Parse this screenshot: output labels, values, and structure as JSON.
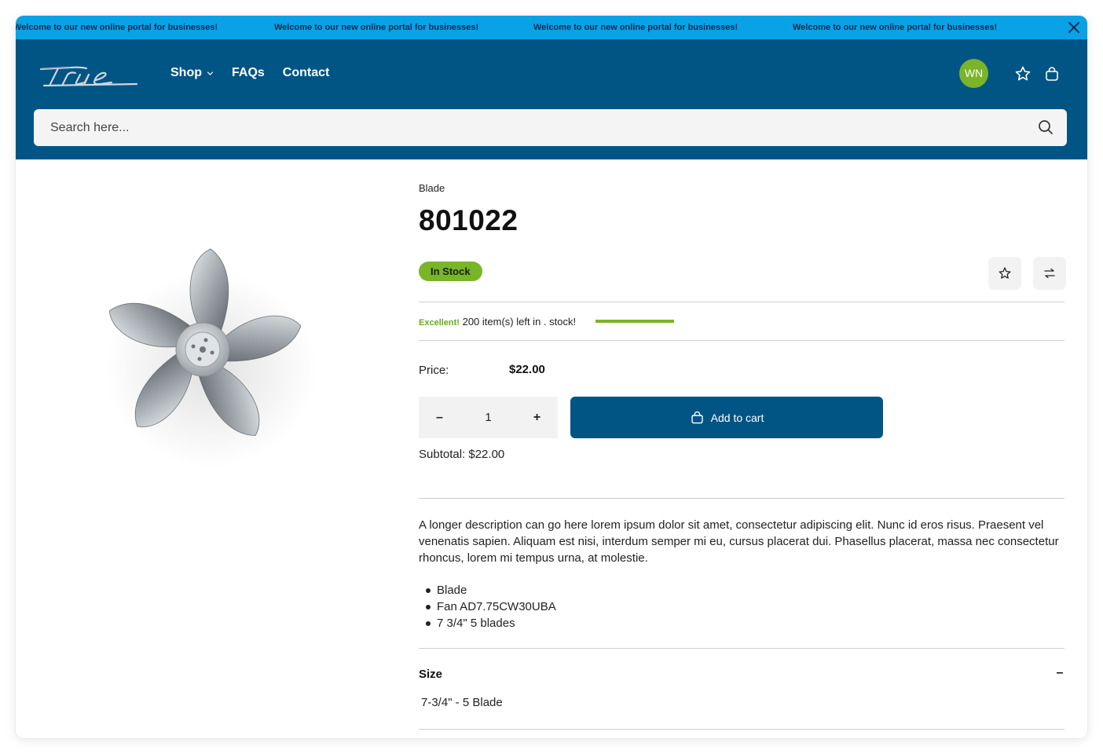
{
  "announcement": {
    "messages": [
      "Welcome to our new online portal for businesses!",
      "Welcome to our new online portal for businesses!",
      "Welcome to our new online portal for businesses!",
      "Welcome to our new online portal for businesses!"
    ],
    "close_icon": "close-icon"
  },
  "header": {
    "logo_alt": "True",
    "nav": [
      {
        "label": "Shop",
        "has_dropdown": true
      },
      {
        "label": "FAQs"
      },
      {
        "label": "Contact"
      }
    ],
    "avatar_initials": "WN",
    "icons": [
      "star-icon",
      "shopping-bag-icon"
    ],
    "colors": {
      "header_bg": "#005585",
      "announce_bg": "#0aa2e6",
      "accent_green": "#7ab428"
    }
  },
  "search": {
    "placeholder": "Search here...",
    "icon": "search-icon"
  },
  "product": {
    "breadcrumb": "Blade",
    "title": "801022",
    "stock_badge": "In Stock",
    "stock_message": {
      "highlight": "Excellent!",
      "text": "200 item(s) left in . stock!",
      "level": 1.0
    },
    "price_label": "Price:",
    "price_value": "$22.00",
    "quantity": "1",
    "quantity_minus": "–",
    "quantity_plus": "+",
    "add_to_cart": "Add to cart",
    "subtotal": "Subtotal: $22.00",
    "description": "A longer description can go here lorem ipsum dolor sit amet, consectetur adipiscing elit. Nunc id eros risus. Praesent vel venenatis sapien. Aliquam est nisi, interdum semper mi eu, cursus placerat dui. Phasellus placerat, massa nec consectetur rhoncus, lorem mi tempus urna, at molestie.",
    "bullets": [
      "Blade",
      "Fan AD7.75CW30UBA",
      "7 3/4\" 5 blades"
    ],
    "size": {
      "title": "Size",
      "toggle": "–",
      "value": "7-3/4\" - 5 Blade"
    }
  }
}
